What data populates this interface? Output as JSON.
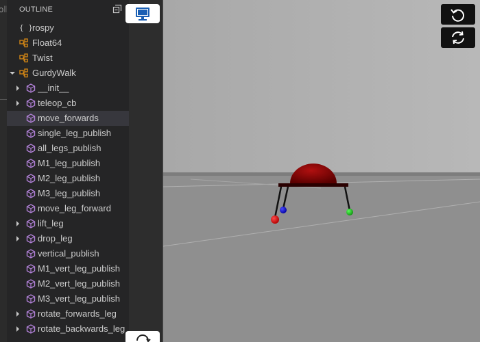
{
  "outline": {
    "title": "OUTLINE",
    "items": [
      {
        "label": "rospy",
        "kind": "module",
        "twistie": "none"
      },
      {
        "label": "Float64",
        "kind": "class",
        "twistie": "none"
      },
      {
        "label": "Twist",
        "kind": "class",
        "twistie": "none"
      },
      {
        "label": "GurdyWalk",
        "kind": "class",
        "twistie": "expanded"
      },
      {
        "label": "__init__",
        "kind": "method",
        "twistie": "collapsed"
      },
      {
        "label": "teleop_cb",
        "kind": "method",
        "twistie": "collapsed"
      },
      {
        "label": "move_forwards",
        "kind": "method",
        "twistie": "none",
        "selected": true
      },
      {
        "label": "single_leg_publish",
        "kind": "method",
        "twistie": "none"
      },
      {
        "label": "all_legs_publish",
        "kind": "method",
        "twistie": "none"
      },
      {
        "label": "M1_leg_publish",
        "kind": "method",
        "twistie": "none"
      },
      {
        "label": "M2_leg_publish",
        "kind": "method",
        "twistie": "none"
      },
      {
        "label": "M3_leg_publish",
        "kind": "method",
        "twistie": "none"
      },
      {
        "label": "move_leg_forward",
        "kind": "method",
        "twistie": "none"
      },
      {
        "label": "lift_leg",
        "kind": "method",
        "twistie": "collapsed"
      },
      {
        "label": "drop_leg",
        "kind": "method",
        "twistie": "collapsed"
      },
      {
        "label": "vertical_publish",
        "kind": "method",
        "twistie": "none"
      },
      {
        "label": "M1_vert_leg_publish",
        "kind": "method",
        "twistie": "none"
      },
      {
        "label": "M2_vert_leg_publish",
        "kind": "method",
        "twistie": "none"
      },
      {
        "label": "M3_vert_leg_publish",
        "kind": "method",
        "twistie": "none"
      },
      {
        "label": "rotate_forwards_leg",
        "kind": "method",
        "twistie": "collapsed"
      },
      {
        "label": "rotate_backwards_leg",
        "kind": "method",
        "twistie": "collapsed"
      }
    ]
  },
  "editor_strip": {
    "clipped_text": "oll"
  },
  "buttons": {
    "monitor": {
      "icon": "monitor-icon"
    },
    "reload": {
      "icon": "reload-icon"
    },
    "reset_view": {
      "icon": "rotate-ccw-icon"
    },
    "sync": {
      "icon": "sync-icon"
    }
  },
  "colors": {
    "class_icon": "#d18616",
    "method_icon": "#b180d7",
    "panel_bg": "#252526",
    "selected_row": "#37373d",
    "sky": "#b2b2b2",
    "ground": "#8e8e8e",
    "robot_body": "#8b0000",
    "monitor_accent": "#1a5fb4"
  }
}
